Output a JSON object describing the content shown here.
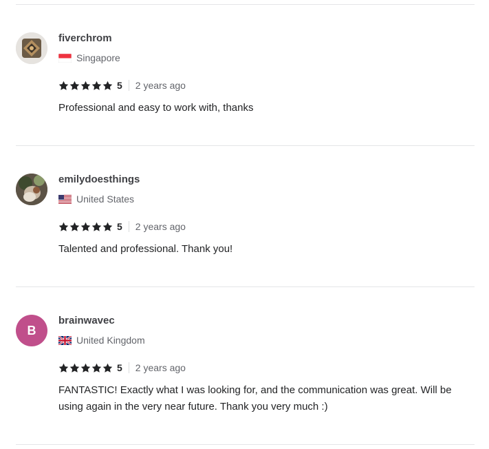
{
  "colors": {
    "divider": "#e4e5e7",
    "star": "#222325",
    "avatar_b_bg": "#c04f8b"
  },
  "reviews": [
    {
      "username": "fiverchrom",
      "country": "Singapore",
      "flag": "singapore-flag-icon",
      "avatar": "photo",
      "rating": "5",
      "time_ago": "2 years ago",
      "text": "Professional and easy to work with, thanks"
    },
    {
      "username": "emilydoesthings",
      "country": "United States",
      "flag": "us-flag-icon",
      "avatar": "photo",
      "rating": "5",
      "time_ago": "2 years ago",
      "text": "Talented and professional. Thank you!"
    },
    {
      "username": "brainwavec",
      "country": "United Kingdom",
      "flag": "uk-flag-icon",
      "avatar_letter": "B",
      "rating": "5",
      "time_ago": "2 years ago",
      "text": "FANTASTIC! Exactly what I was looking for, and the communication was great. Will be using again in the very near future. Thank you very much :)"
    }
  ]
}
